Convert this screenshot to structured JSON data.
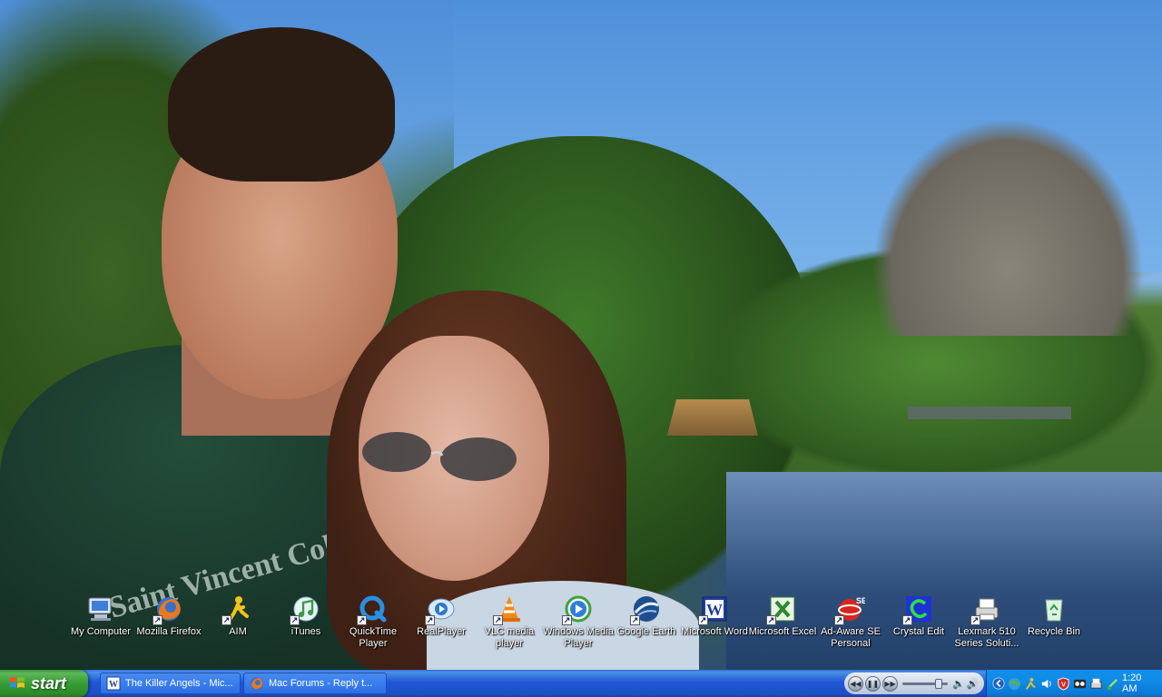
{
  "desktop": {
    "icons": [
      {
        "label": "My Computer",
        "icon": "my-computer-icon",
        "shortcut": false
      },
      {
        "label": "Mozilla Firefox",
        "icon": "firefox-icon",
        "shortcut": true
      },
      {
        "label": "AIM",
        "icon": "aim-icon",
        "shortcut": true
      },
      {
        "label": "iTunes",
        "icon": "itunes-icon",
        "shortcut": true
      },
      {
        "label": "QuickTime Player",
        "icon": "quicktime-icon",
        "shortcut": true
      },
      {
        "label": "RealPlayer",
        "icon": "realplayer-icon",
        "shortcut": true
      },
      {
        "label": "VLC media player",
        "icon": "vlc-icon",
        "shortcut": true
      },
      {
        "label": "Windows Media Player",
        "icon": "windows-media-player-icon",
        "shortcut": true
      },
      {
        "label": "Google Earth",
        "icon": "google-earth-icon",
        "shortcut": true
      },
      {
        "label": "Microsoft Word",
        "icon": "microsoft-word-icon",
        "shortcut": true
      },
      {
        "label": "Microsoft Excel",
        "icon": "microsoft-excel-icon",
        "shortcut": true
      },
      {
        "label": "Ad-Aware SE Personal",
        "icon": "ad-aware-icon",
        "shortcut": true
      },
      {
        "label": "Crystal Edit",
        "icon": "crystal-edit-icon",
        "shortcut": true
      },
      {
        "label": "Lexmark 510 Series Soluti...",
        "icon": "lexmark-printer-icon",
        "shortcut": true
      },
      {
        "label": "Recycle Bin",
        "icon": "recycle-bin-icon",
        "shortcut": false
      }
    ],
    "wallpaper_text": "Saint Vincent College"
  },
  "taskbar": {
    "start_label": "start",
    "tasks": [
      {
        "label": "The Killer Angels - Mic...",
        "icon": "microsoft-word-icon"
      },
      {
        "label": "Mac Forums - Reply t...",
        "icon": "firefox-icon"
      }
    ],
    "media_controls": [
      "previous",
      "pause",
      "next",
      "mute",
      "volume-up"
    ],
    "volume_level": 0.85,
    "tray_icons": [
      "show-hidden-chevron-icon",
      "network-globe-icon",
      "aim-tray-icon",
      "volume-tray-icon",
      "antivirus-shield-icon",
      "messenger-icon",
      "lexmark-tray-icon",
      "safely-remove-hardware-icon"
    ],
    "clock": "1:20 AM"
  },
  "colors": {
    "taskbar_blue": "#245edb",
    "start_green": "#379d33",
    "tray_blue": "#0e8ae4"
  }
}
